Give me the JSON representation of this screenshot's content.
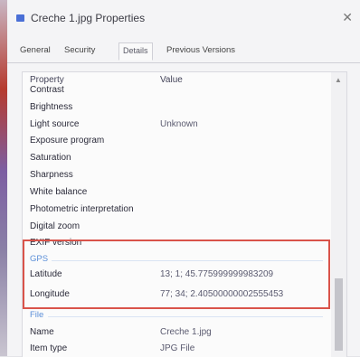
{
  "window": {
    "title": "Creche 1.jpg Properties",
    "close_glyph": "✕"
  },
  "tabs": [
    {
      "label": "General",
      "active": false
    },
    {
      "label": "Security",
      "active": false
    },
    {
      "label": "Details",
      "active": true
    },
    {
      "label": "Previous Versions",
      "active": false
    }
  ],
  "details": {
    "col_property": "Property",
    "col_value": "Value",
    "rows": [
      {
        "k": "Contrast",
        "v": ""
      },
      {
        "k": "Brightness",
        "v": ""
      },
      {
        "k": "Light source",
        "v": "Unknown"
      },
      {
        "k": "Exposure program",
        "v": ""
      },
      {
        "k": "Saturation",
        "v": ""
      },
      {
        "k": "Sharpness",
        "v": ""
      },
      {
        "k": "White balance",
        "v": ""
      },
      {
        "k": "Photometric interpretation",
        "v": ""
      },
      {
        "k": "Digital zoom",
        "v": ""
      },
      {
        "k": "EXIF version",
        "v": ""
      }
    ],
    "gps_section": "GPS",
    "gps_rows": [
      {
        "k": "Latitude",
        "v": "13; 1; 45.775999999983209"
      },
      {
        "k": "Longitude",
        "v": "77; 34; 2.40500000002555453"
      }
    ],
    "file_section": "File",
    "file_rows": [
      {
        "k": "Name",
        "v": "Creche 1.jpg"
      },
      {
        "k": "Item type",
        "v": "JPG File"
      }
    ]
  },
  "colors": {
    "highlight": "#d9534a",
    "section": "#5b8fd8"
  }
}
